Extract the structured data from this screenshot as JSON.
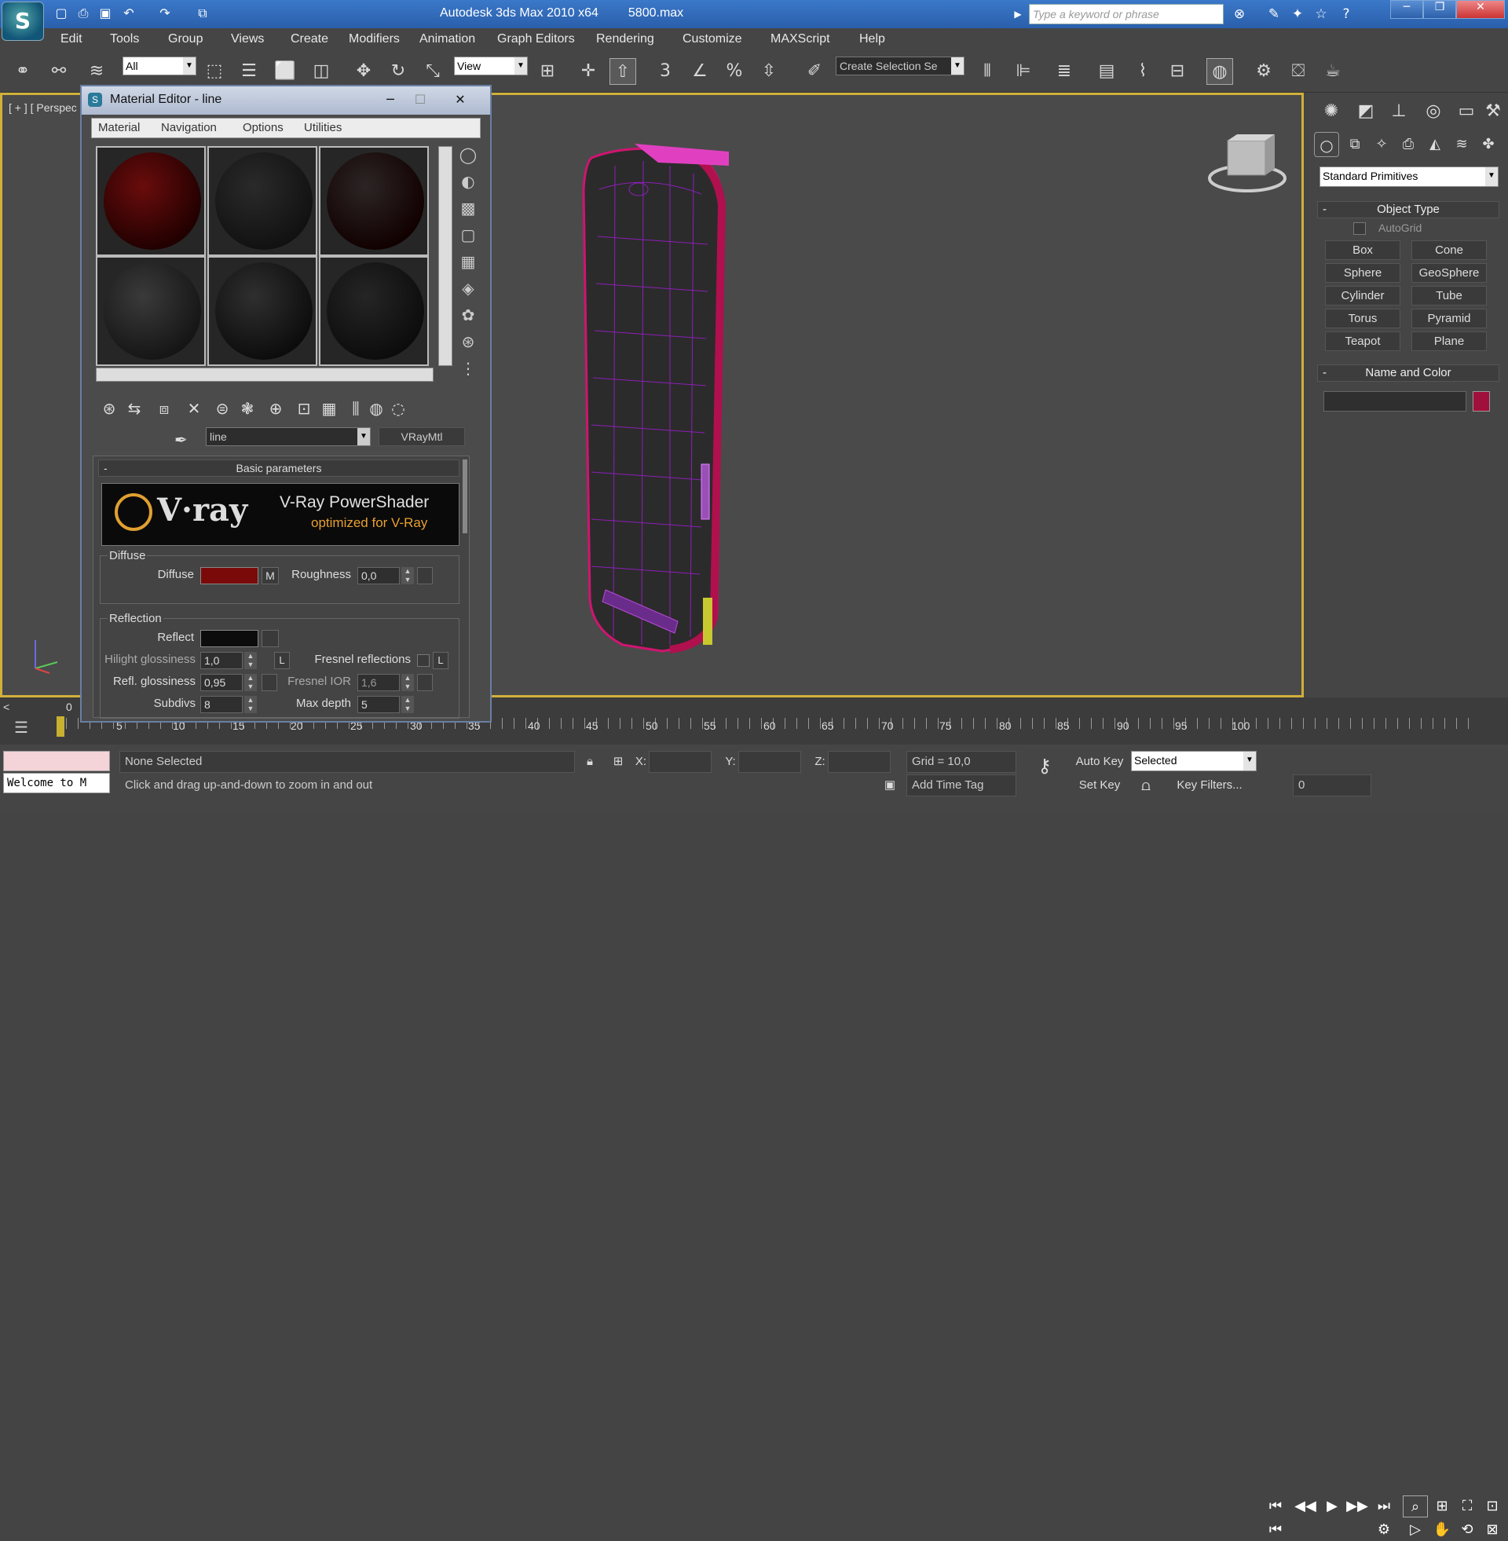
{
  "app": {
    "logo_glyph": "S",
    "title": "Autodesk 3ds Max  2010 x64",
    "file": "5800.max"
  },
  "quick_access": [
    "new-icon",
    "open-icon",
    "save-icon",
    "undo-icon",
    "redo-icon",
    "project-icon"
  ],
  "search": {
    "placeholder": "Type a keyword or phrase"
  },
  "menu": [
    "Edit",
    "Tools",
    "Group",
    "Views",
    "Create",
    "Modifiers",
    "Animation",
    "Graph Editors",
    "Rendering",
    "Customize",
    "MAXScript",
    "Help"
  ],
  "toolbar": {
    "filter": "All",
    "ref_coord": "View",
    "snap_angle": "3",
    "selection_set": "Create Selection Se"
  },
  "viewport": {
    "label": "[ + ] [ Perspec",
    "frame_start": "0"
  },
  "command_panel": {
    "dropdown": "Standard Primitives",
    "object_type_title": "Object Type",
    "autogrid": "AutoGrid",
    "buttons": [
      "Box",
      "Cone",
      "Sphere",
      "GeoSphere",
      "Cylinder",
      "Tube",
      "Torus",
      "Pyramid",
      "Teapot",
      "Plane"
    ],
    "name_color_title": "Name and Color",
    "object_name": "",
    "color": "#a0103a"
  },
  "material_editor": {
    "title": "Material Editor - line",
    "menu": [
      "Material",
      "Navigation",
      "Options",
      "Utilities"
    ],
    "material_name": "line",
    "material_type": "VRayMtl",
    "rollout_title": "Basic parameters",
    "banner_logo": "V·ray",
    "banner_title": "V-Ray PowerShader",
    "banner_subtitle": "optimized for V-Ray",
    "diffuse_group": "Diffuse",
    "diffuse_label": "Diffuse",
    "diffuse_color": "#7a0a0a",
    "diffuse_map": "M",
    "roughness_label": "Roughness",
    "roughness": "0,0",
    "reflection_group": "Reflection",
    "reflect_label": "Reflect",
    "hilight_label": "Hilight glossiness",
    "hilight": "1,0",
    "lock": "L",
    "fresnel_label": "Fresnel reflections",
    "fresnel_lock": "L",
    "refl_gloss_label": "Refl. glossiness",
    "refl_gloss": "0,95",
    "fresnel_ior_label": "Fresnel IOR",
    "fresnel_ior": "1,6",
    "subdivs_label": "Subdivs",
    "subdivs": "8",
    "max_depth_label": "Max depth",
    "max_depth": "5"
  },
  "timeline": {
    "ticks": [
      "5",
      "10",
      "15",
      "20",
      "25",
      "30",
      "35",
      "40",
      "45",
      "50",
      "55",
      "60",
      "65",
      "70",
      "75",
      "80",
      "85",
      "90",
      "95",
      "100"
    ]
  },
  "status": {
    "listener": "Welcome to M",
    "selection": "None Selected",
    "prompt": "Click and drag up-and-down to zoom in and out",
    "x_label": "X:",
    "y_label": "Y:",
    "z_label": "Z:",
    "grid": "Grid = 10,0",
    "add_time_tag": "Add Time Tag",
    "auto_key": "Auto Key",
    "key_mode": "Selected",
    "set_key": "Set Key",
    "key_filters": "Key Filters...",
    "frame": "0"
  }
}
